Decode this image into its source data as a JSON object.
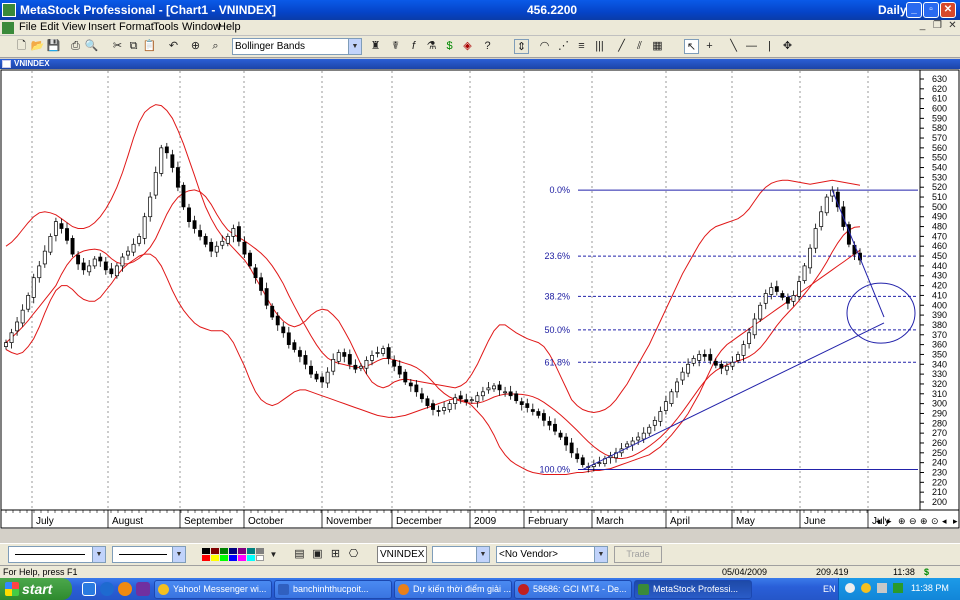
{
  "window": {
    "app_title": "MetaStock Professional - [Chart1 - VNINDEX]",
    "price_readout": "456.2200",
    "periodicity": "Daily"
  },
  "menu": {
    "items": [
      "File",
      "Edit",
      "View",
      "Insert",
      "Format",
      "Tools",
      "Window",
      "Help"
    ]
  },
  "toolbar": {
    "indicator_combo_value": "Bollinger Bands"
  },
  "chart_window": {
    "title": "VNINDEX"
  },
  "chart_data": {
    "type": "candlestick",
    "security": "VNINDEX",
    "overlay": "Bollinger Bands",
    "y_axis": {
      "min": 200,
      "max": 630,
      "step": 10,
      "tick_labels": [
        "630",
        "620",
        "610",
        "600",
        "590",
        "580",
        "570",
        "560",
        "550",
        "540",
        "530",
        "520",
        "510",
        "500",
        "490",
        "480",
        "470",
        "460",
        "450",
        "440",
        "430",
        "420",
        "410",
        "400",
        "390",
        "380",
        "370",
        "360",
        "350",
        "340",
        "330",
        "320",
        "310",
        "300",
        "290",
        "280",
        "270",
        "260",
        "250",
        "240",
        "230",
        "220",
        "210",
        "200"
      ]
    },
    "x_axis": {
      "month_labels": [
        "July",
        "August",
        "September",
        "October",
        "November",
        "December",
        "2009",
        "February",
        "March",
        "April",
        "May",
        "June",
        "July"
      ]
    },
    "fibonacci": {
      "high": 517,
      "low": 233,
      "levels": [
        {
          "label": "0.0%",
          "value": 517
        },
        {
          "label": "23.6%",
          "value": 450
        },
        {
          "label": "38.2%",
          "value": 409
        },
        {
          "label": "50.0%",
          "value": 375
        },
        {
          "label": "61.8%",
          "value": 342
        },
        {
          "label": "100.0%",
          "value": 233
        }
      ]
    },
    "closes": [
      362,
      372,
      383,
      395,
      410,
      428,
      440,
      455,
      470,
      485,
      478,
      466,
      452,
      442,
      436,
      440,
      447,
      445,
      436,
      432,
      440,
      449,
      455,
      462,
      470,
      490,
      510,
      535,
      560,
      555,
      540,
      520,
      500,
      485,
      478,
      470,
      462,
      455,
      460,
      465,
      470,
      478,
      465,
      452,
      440,
      428,
      415,
      400,
      388,
      380,
      372,
      360,
      355,
      348,
      340,
      330,
      325,
      322,
      332,
      345,
      352,
      348,
      340,
      335,
      338,
      344,
      349,
      352,
      356,
      346,
      338,
      330,
      322,
      318,
      312,
      305,
      298,
      294,
      292,
      296,
      300,
      306,
      305,
      302,
      304,
      308,
      312,
      316,
      318,
      314,
      312,
      308,
      303,
      299,
      296,
      292,
      288,
      283,
      278,
      272,
      266,
      258,
      250,
      244,
      238,
      236,
      238,
      240,
      244,
      247,
      250,
      254,
      259,
      262,
      266,
      270,
      276,
      283,
      292,
      302,
      312,
      322,
      332,
      340,
      346,
      350,
      348,
      344,
      339,
      336,
      338,
      342,
      350,
      360,
      372,
      386,
      400,
      412,
      418,
      414,
      408,
      402,
      410,
      424,
      440,
      458,
      478,
      495,
      510,
      517,
      500,
      480,
      462,
      452,
      446
    ],
    "upper_band": [
      460,
      464,
      470,
      477,
      484,
      490,
      494,
      495,
      494,
      492,
      488,
      484,
      480,
      478,
      478,
      480,
      484,
      490,
      498,
      508,
      520,
      535,
      552,
      570,
      586,
      596,
      601,
      604,
      603,
      598,
      590,
      578,
      564,
      548,
      532,
      515,
      500,
      488,
      478,
      470,
      464,
      458,
      452,
      446,
      438,
      428,
      418,
      408,
      398,
      390,
      384,
      380,
      378,
      380,
      384,
      390,
      394,
      396,
      395,
      390,
      384,
      374,
      364,
      352,
      340,
      330,
      322,
      318,
      316,
      318,
      322,
      324,
      325,
      324,
      323,
      322,
      321,
      320,
      319,
      318,
      317,
      316,
      318,
      322,
      330,
      340,
      352,
      364,
      374,
      380,
      380,
      376,
      372,
      369,
      366,
      364,
      362,
      358,
      350,
      340,
      328,
      316,
      304,
      298,
      294,
      292,
      291,
      292,
      294,
      298,
      304,
      312,
      320,
      330,
      340,
      350,
      360,
      372,
      384,
      396,
      408,
      420,
      432,
      442,
      452,
      462,
      470,
      476,
      480,
      482,
      484,
      486,
      488,
      492,
      498,
      506,
      514,
      520,
      524,
      526,
      527,
      527,
      526,
      525,
      524,
      523,
      524,
      525,
      526,
      527,
      526,
      525,
      524,
      523,
      522
    ],
    "lower_band": [
      355,
      352,
      350,
      352,
      358,
      366,
      378,
      392,
      405,
      415,
      420,
      420,
      416,
      410,
      406,
      404,
      404,
      408,
      415,
      422,
      430,
      437,
      442,
      446,
      450,
      452,
      452,
      448,
      440,
      428,
      415,
      404,
      395,
      388,
      382,
      378,
      376,
      374,
      374,
      374,
      370,
      362,
      350,
      338,
      324,
      312,
      304,
      300,
      298,
      300,
      304,
      308,
      312,
      314,
      314,
      312,
      310,
      308,
      306,
      304,
      302,
      300,
      298,
      296,
      294,
      292,
      290,
      288,
      287,
      286,
      286,
      287,
      288,
      290,
      292,
      294,
      296,
      298,
      300,
      302,
      304,
      305,
      304,
      302,
      298,
      292,
      286,
      278,
      268,
      256,
      248,
      242,
      238,
      235,
      232,
      230,
      229,
      228,
      228,
      228,
      228,
      228,
      229,
      230,
      230,
      231,
      232,
      232,
      233,
      234,
      236,
      238,
      240,
      242,
      244,
      246,
      248,
      252,
      256,
      262,
      268,
      275,
      282,
      290,
      300,
      310,
      322,
      334,
      346,
      354,
      360,
      364,
      368,
      372,
      376,
      380,
      384,
      388,
      392,
      396,
      400,
      404,
      408,
      412,
      416,
      420,
      424,
      428,
      432,
      436,
      440,
      444,
      448,
      452,
      456
    ]
  },
  "bottom_toolbar": {
    "security_box": "VNINDEX",
    "vendor_combo": "<No Vendor>",
    "trade_button": "Trade"
  },
  "status": {
    "help_text": "For Help, press F1",
    "date": "05/04/2009",
    "value": "209.419",
    "time": "11:38"
  },
  "taskbar": {
    "start_label": "start",
    "tasks": [
      {
        "label": "Yahoo! Messenger wi...",
        "color": "#f4c020"
      },
      {
        "label": "banchinhthucpoit...",
        "color": "#3060c0"
      },
      {
        "label": "Dự kiến thời điểm giải ...",
        "color": "#e8801a"
      },
      {
        "label": "58686: GCI MT4 - De...",
        "color": "#c02020"
      },
      {
        "label": "MetaStock Professi...",
        "color": "#3a8a3a"
      }
    ],
    "tray_lang": "EN",
    "tray_time": "11:38 PM"
  }
}
